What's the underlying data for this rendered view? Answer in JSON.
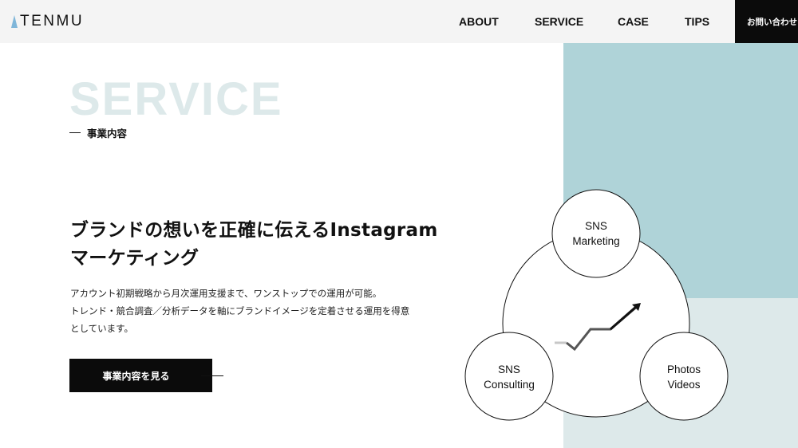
{
  "header": {
    "logo_text": "TENMU",
    "nav": [
      {
        "label": "ABOUT"
      },
      {
        "label": "SERVICE"
      },
      {
        "label": "CASE"
      },
      {
        "label": "TIPS"
      }
    ],
    "contact_label": "お問い合わせ"
  },
  "section": {
    "title_en": "SERVICE",
    "title_jp": "事業内容"
  },
  "hero": {
    "headline_line1": "ブランドの想いを正確に伝えるInstagram",
    "headline_line2": "マーケティング",
    "desc_line1": "アカウント初期戦略から月次運用支援まで、ワンストップでの運用が可能。",
    "desc_line2": "トレンド・競合調査／分析データを軸にブランドイメージを定着させる運用を得意",
    "desc_line3": "としています。",
    "cta_label": "事業内容を見る"
  },
  "diagram": {
    "top": {
      "line1": "SNS",
      "line2": "Marketing"
    },
    "left": {
      "line1": "SNS",
      "line2": "Consulting"
    },
    "right": {
      "line1": "Photos",
      "line2": "Videos"
    }
  },
  "colors": {
    "teal": "#afd3d8",
    "light_teal": "#dde9ea",
    "black": "#0b0b0b",
    "header_bg": "#f4f4f4"
  },
  "icons": {
    "logo_mark": "triangle-mark-icon",
    "trend": "trend-arrow-icon"
  }
}
